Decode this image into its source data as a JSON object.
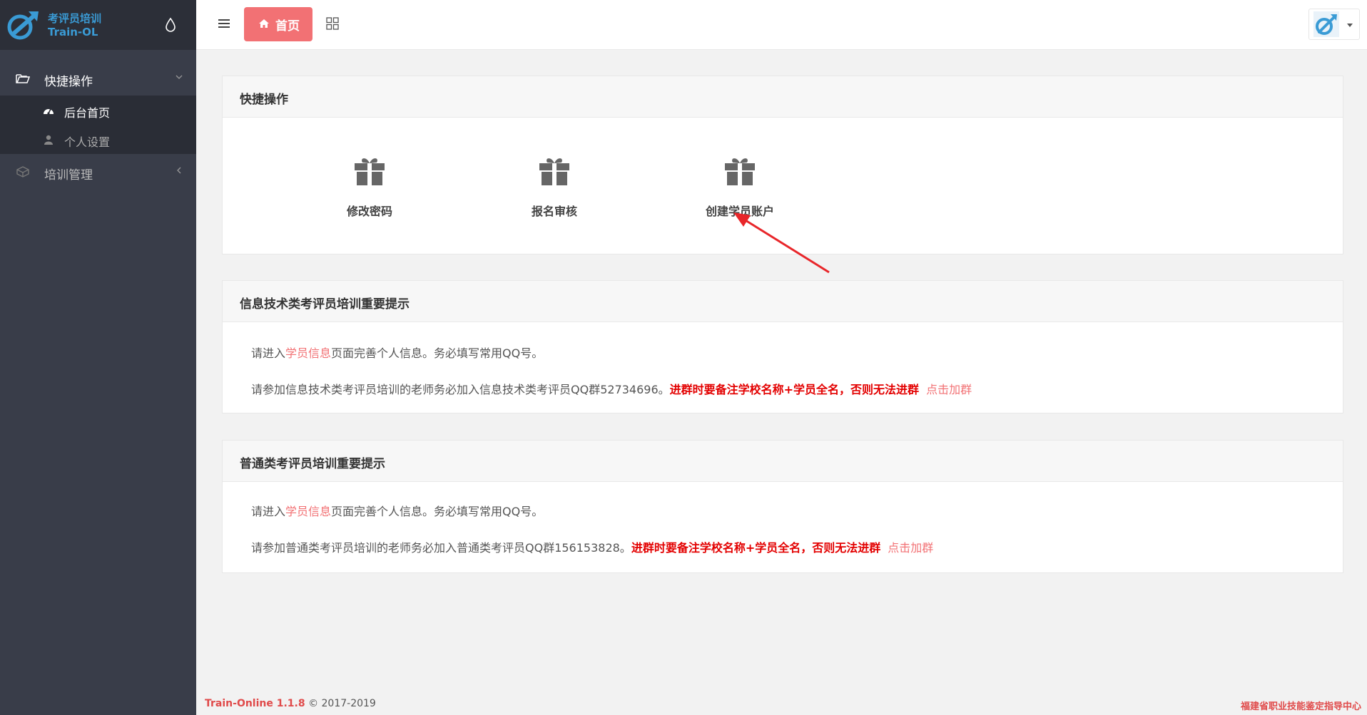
{
  "app": {
    "logo_title": "考评员培训",
    "logo_subtitle": "Train-OL"
  },
  "sidebar": {
    "items": [
      {
        "label": "快捷操作",
        "icon": "folder-open-icon",
        "expanded": true
      },
      {
        "label": "培训管理",
        "icon": "cube-icon",
        "expanded": false
      }
    ],
    "sub_items": [
      {
        "label": "后台首页",
        "icon": "dashboard-icon",
        "active": true
      },
      {
        "label": "个人设置",
        "icon": "user-icon",
        "active": false
      }
    ]
  },
  "header": {
    "home_tab": "首页"
  },
  "quick_actions": {
    "title": "快捷操作",
    "items": [
      {
        "label": "修改密码",
        "icon": "gift-icon"
      },
      {
        "label": "报名审核",
        "icon": "gift-icon"
      },
      {
        "label": "创建学员账户",
        "icon": "gift-icon"
      }
    ]
  },
  "it_notice": {
    "title": "信息技术类考评员培训重要提示",
    "line1_pre": "请进入",
    "line1_link": "学员信息",
    "line1_post": "页面完善个人信息。务必填写常用QQ号。",
    "line2_pre": "请参加信息技术类考评员培训的老师务必加入信息技术类考评员QQ群52734696。",
    "line2_warn": "进群时要备注学校名称+学员全名，否则无法进群",
    "line2_link": "点击加群"
  },
  "general_notice": {
    "title": "普通类考评员培训重要提示",
    "line1_pre": "请进入",
    "line1_link": "学员信息",
    "line1_post": "页面完善个人信息。务必填写常用QQ号。",
    "line2_pre": "请参加普通类考评员培训的老师务必加入普通类考评员QQ群156153828。",
    "line2_warn": "进群时要备注学校名称+学员全名，否则无法进群",
    "line2_link": "点击加群"
  },
  "footer": {
    "version": "Train-Online 1.1.8",
    "copyright": "© 2017-2019",
    "org": "福建省职业技能鉴定指导中心"
  },
  "colors": {
    "sidebar_bg": "#393d49",
    "accent": "#f27174",
    "warn": "#e30000",
    "logo": "#3a9bd5"
  }
}
